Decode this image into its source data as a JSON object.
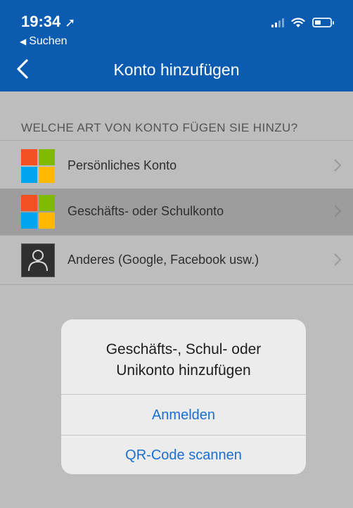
{
  "status_bar": {
    "time": "19:34",
    "back_app": "Suchen"
  },
  "nav": {
    "title": "Konto hinzufügen"
  },
  "section": {
    "title": "WELCHE ART VON KONTO FÜGEN SIE HINZU?"
  },
  "accounts": [
    {
      "label": "Persönliches Konto",
      "icon": "microsoft-logo-icon"
    },
    {
      "label": "Geschäfts- oder Schulkonto",
      "icon": "microsoft-logo-icon",
      "selected": true
    },
    {
      "label": "Anderes (Google, Facebook usw.)",
      "icon": "person-icon"
    }
  ],
  "dialog": {
    "title_line1": "Geschäfts-, Schul- oder",
    "title_line2": "Unikonto hinzufügen",
    "sign_in": "Anmelden",
    "scan_qr": "QR-Code scannen"
  },
  "colors": {
    "header": "#0b5cb1",
    "ms_red": "#f25022",
    "ms_green": "#7fba00",
    "ms_blue": "#00a4ef",
    "ms_yellow": "#ffb900",
    "link": "#1a6fd1"
  }
}
